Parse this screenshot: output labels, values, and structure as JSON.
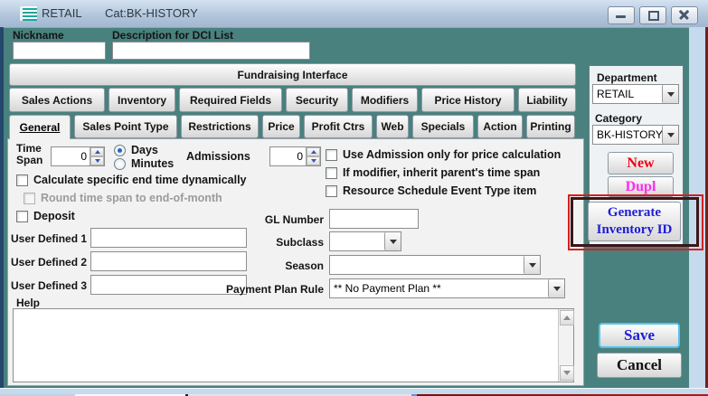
{
  "window": {
    "title": "RETAIL",
    "category_caption": "Cat:BK-HISTORY",
    "icons": {
      "title": "list-icon",
      "minimize": "minimize-icon",
      "restore": "restore-icon",
      "close": "close-icon",
      "dropdown": "chevron-down-icon",
      "spinner": "chevron-up-down-icons",
      "scrollbar": "chevron-up-down-icons"
    }
  },
  "header": {
    "nickname_label": "Nickname",
    "nickname_value": "",
    "description_label": "Description for DCI List",
    "description_value": ""
  },
  "fundraising_label": "Fundraising Interface",
  "tabs": {
    "top": [
      "Sales Actions",
      "Inventory",
      "Required Fields",
      "Security",
      "Modifiers",
      "Price History",
      "Liability"
    ],
    "bottom": [
      "General",
      "Sales Point Type",
      "Restrictions",
      "Price",
      "Profit Ctrs",
      "Web",
      "Specials",
      "Action",
      "Printing"
    ],
    "active_bottom": "General"
  },
  "form": {
    "time_label_line1": "Time",
    "time_label_line2": "Span",
    "time_span_value": "0",
    "days_label": "Days",
    "minutes_label": "Minutes",
    "time_unit_selected": "Days",
    "admissions_label": "Admissions",
    "admissions_value": "0",
    "cb_calculate": "Calculate specific end time dynamically",
    "cb_round": "Round time span to end-of-month",
    "cb_deposit": "Deposit",
    "cb_use_admission": "Use Admission only for price calculation",
    "cb_if_modifier": "If modifier, inherit parent's time span",
    "cb_resource": "Resource Schedule Event Type item",
    "gl_label": "GL Number",
    "gl_value": "",
    "ud1_label": "User Defined 1",
    "ud1_value": "",
    "ud2_label": "User Defined 2",
    "ud2_value": "",
    "ud3_label": "User Defined 3",
    "ud3_value": "",
    "subclass_label": "Subclass",
    "subclass_value": "",
    "season_label": "Season",
    "season_value": "",
    "payment_label": "Payment Plan Rule",
    "payment_value": "** No Payment Plan **",
    "help_label": "Help",
    "help_value": ""
  },
  "sidebar": {
    "department_label": "Department",
    "department_value": "RETAIL",
    "category_label": "Category",
    "category_value": "BK-HISTORY",
    "new_label": "New",
    "dupl_label": "Dupl",
    "generate_line1": "Generate",
    "generate_line2": "Inventory ID",
    "save_label": "Save",
    "cancel_label": "Cancel"
  },
  "colors": {
    "teal_background": "#48817e",
    "annotation_red": "#d42020",
    "new_text": "#ee0312",
    "dupl_text": "#ff2bf0",
    "generate_text": "#1c1cd8",
    "save_text": "#1c1cd8",
    "cancel_text": "#111111",
    "save_focus_border": "#55c4ec"
  }
}
